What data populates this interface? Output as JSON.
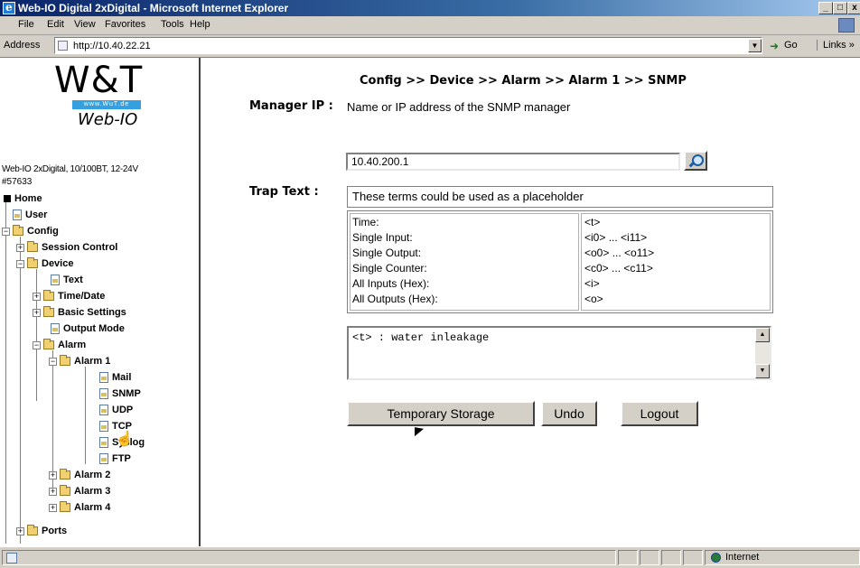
{
  "window": {
    "title": "Web-IO Digital 2xDigital - Microsoft Internet Explorer",
    "minimize": "_",
    "maximize": "□",
    "close": "x"
  },
  "menu": [
    "File",
    "Edit",
    "View",
    "Favorites",
    "Tools",
    "Help"
  ],
  "address": {
    "label": "Address",
    "url": "http://10.40.22.21",
    "go_label": "Go",
    "links_label": "Links »"
  },
  "sidebar": {
    "logo_main": "W&T",
    "logo_url": "www.WuT.de",
    "logo_product": "Web-IO",
    "device_desc": "Web-IO 2xDigital, 10/100BT, 12-24V",
    "device_number": "#57633",
    "tree": {
      "home": "Home",
      "user": "User",
      "config": "Config",
      "session_control": "Session Control",
      "device": "Device",
      "text": "Text",
      "time_date": "Time/Date",
      "basic_settings": "Basic Settings",
      "output_mode": "Output Mode",
      "alarm": "Alarm",
      "alarm1": "Alarm 1",
      "mail": "Mail",
      "snmp": "SNMP",
      "udp": "UDP",
      "tcp": "TCP",
      "syslog": "Syslog",
      "ftp": "FTP",
      "alarm2": "Alarm 2",
      "alarm3": "Alarm 3",
      "alarm4": "Alarm 4",
      "ports": "Ports"
    }
  },
  "main": {
    "breadcrumb": "Config >> Device >> Alarm >> Alarm 1 >> SNMP",
    "manager_label": "Manager IP :",
    "manager_help": "Name or IP address of the SNMP manager",
    "manager_value": "10.40.200.1",
    "trap_label": "Trap Text :",
    "placeholder_title": "These terms could be used as a placeholder",
    "placeholders": [
      {
        "name": "Time:",
        "code": "<t>"
      },
      {
        "name": "Single Input:",
        "code": "<i0> ... <i11>"
      },
      {
        "name": "Single Output:",
        "code": "<o0> ... <o11>"
      },
      {
        "name": "Single Counter:",
        "code": "<c0> ... <c11>"
      },
      {
        "name": "All Inputs (Hex):",
        "code": "<i>"
      },
      {
        "name": "All Outputs (Hex):",
        "code": "<o>"
      }
    ],
    "trap_text": "<t> : water inleakage",
    "buttons": {
      "temp": "Temporary Storage",
      "undo": "Undo",
      "logout": "Logout"
    }
  },
  "status": {
    "zone": "Internet"
  }
}
